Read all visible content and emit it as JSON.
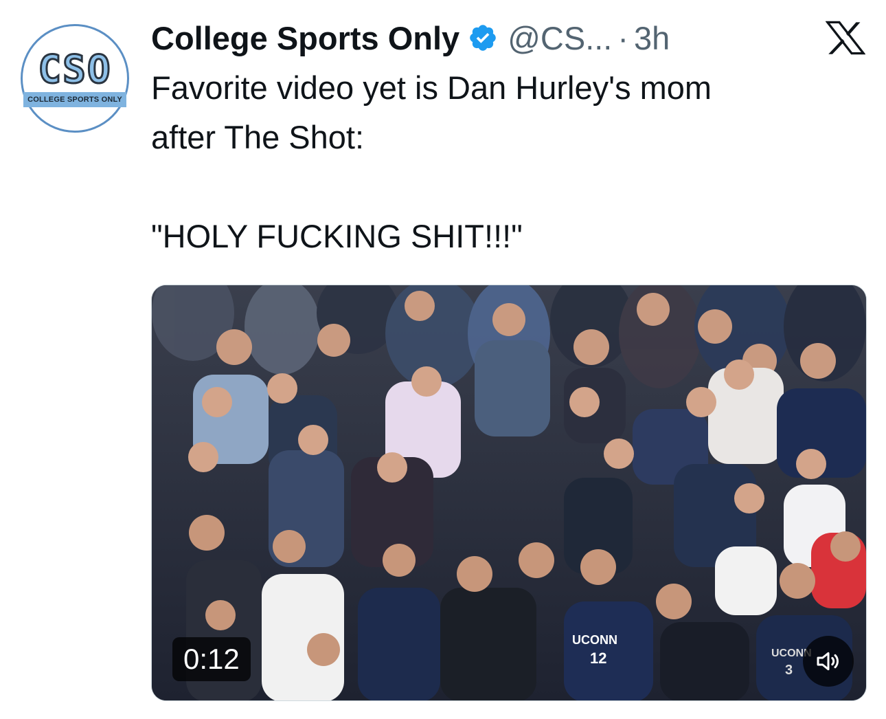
{
  "tweet": {
    "author_name": "College Sports Only",
    "handle": "@CS...",
    "separator": "·",
    "time": "3h",
    "text_line1": "Favorite video yet is Dan Hurley's mom",
    "text_line2": "after The Shot:",
    "quote": "\"HOLY FUCKING SHIT!!!\""
  },
  "avatar": {
    "mark": "CSO",
    "caption": "COLLEGE SPORTS ONLY"
  },
  "video": {
    "duration": "0:12",
    "jersey_left": "UCONN",
    "jersey_number": "12",
    "jersey_right": "UCONN",
    "jersey_right_number": "3"
  },
  "icons": {
    "verified": "verified-badge-icon",
    "platform": "x-logo-icon",
    "mute": "speaker-icon"
  },
  "colors": {
    "verified_blue": "#1d9bf0",
    "handle_gray": "#536471",
    "text_black": "#0f1419"
  }
}
